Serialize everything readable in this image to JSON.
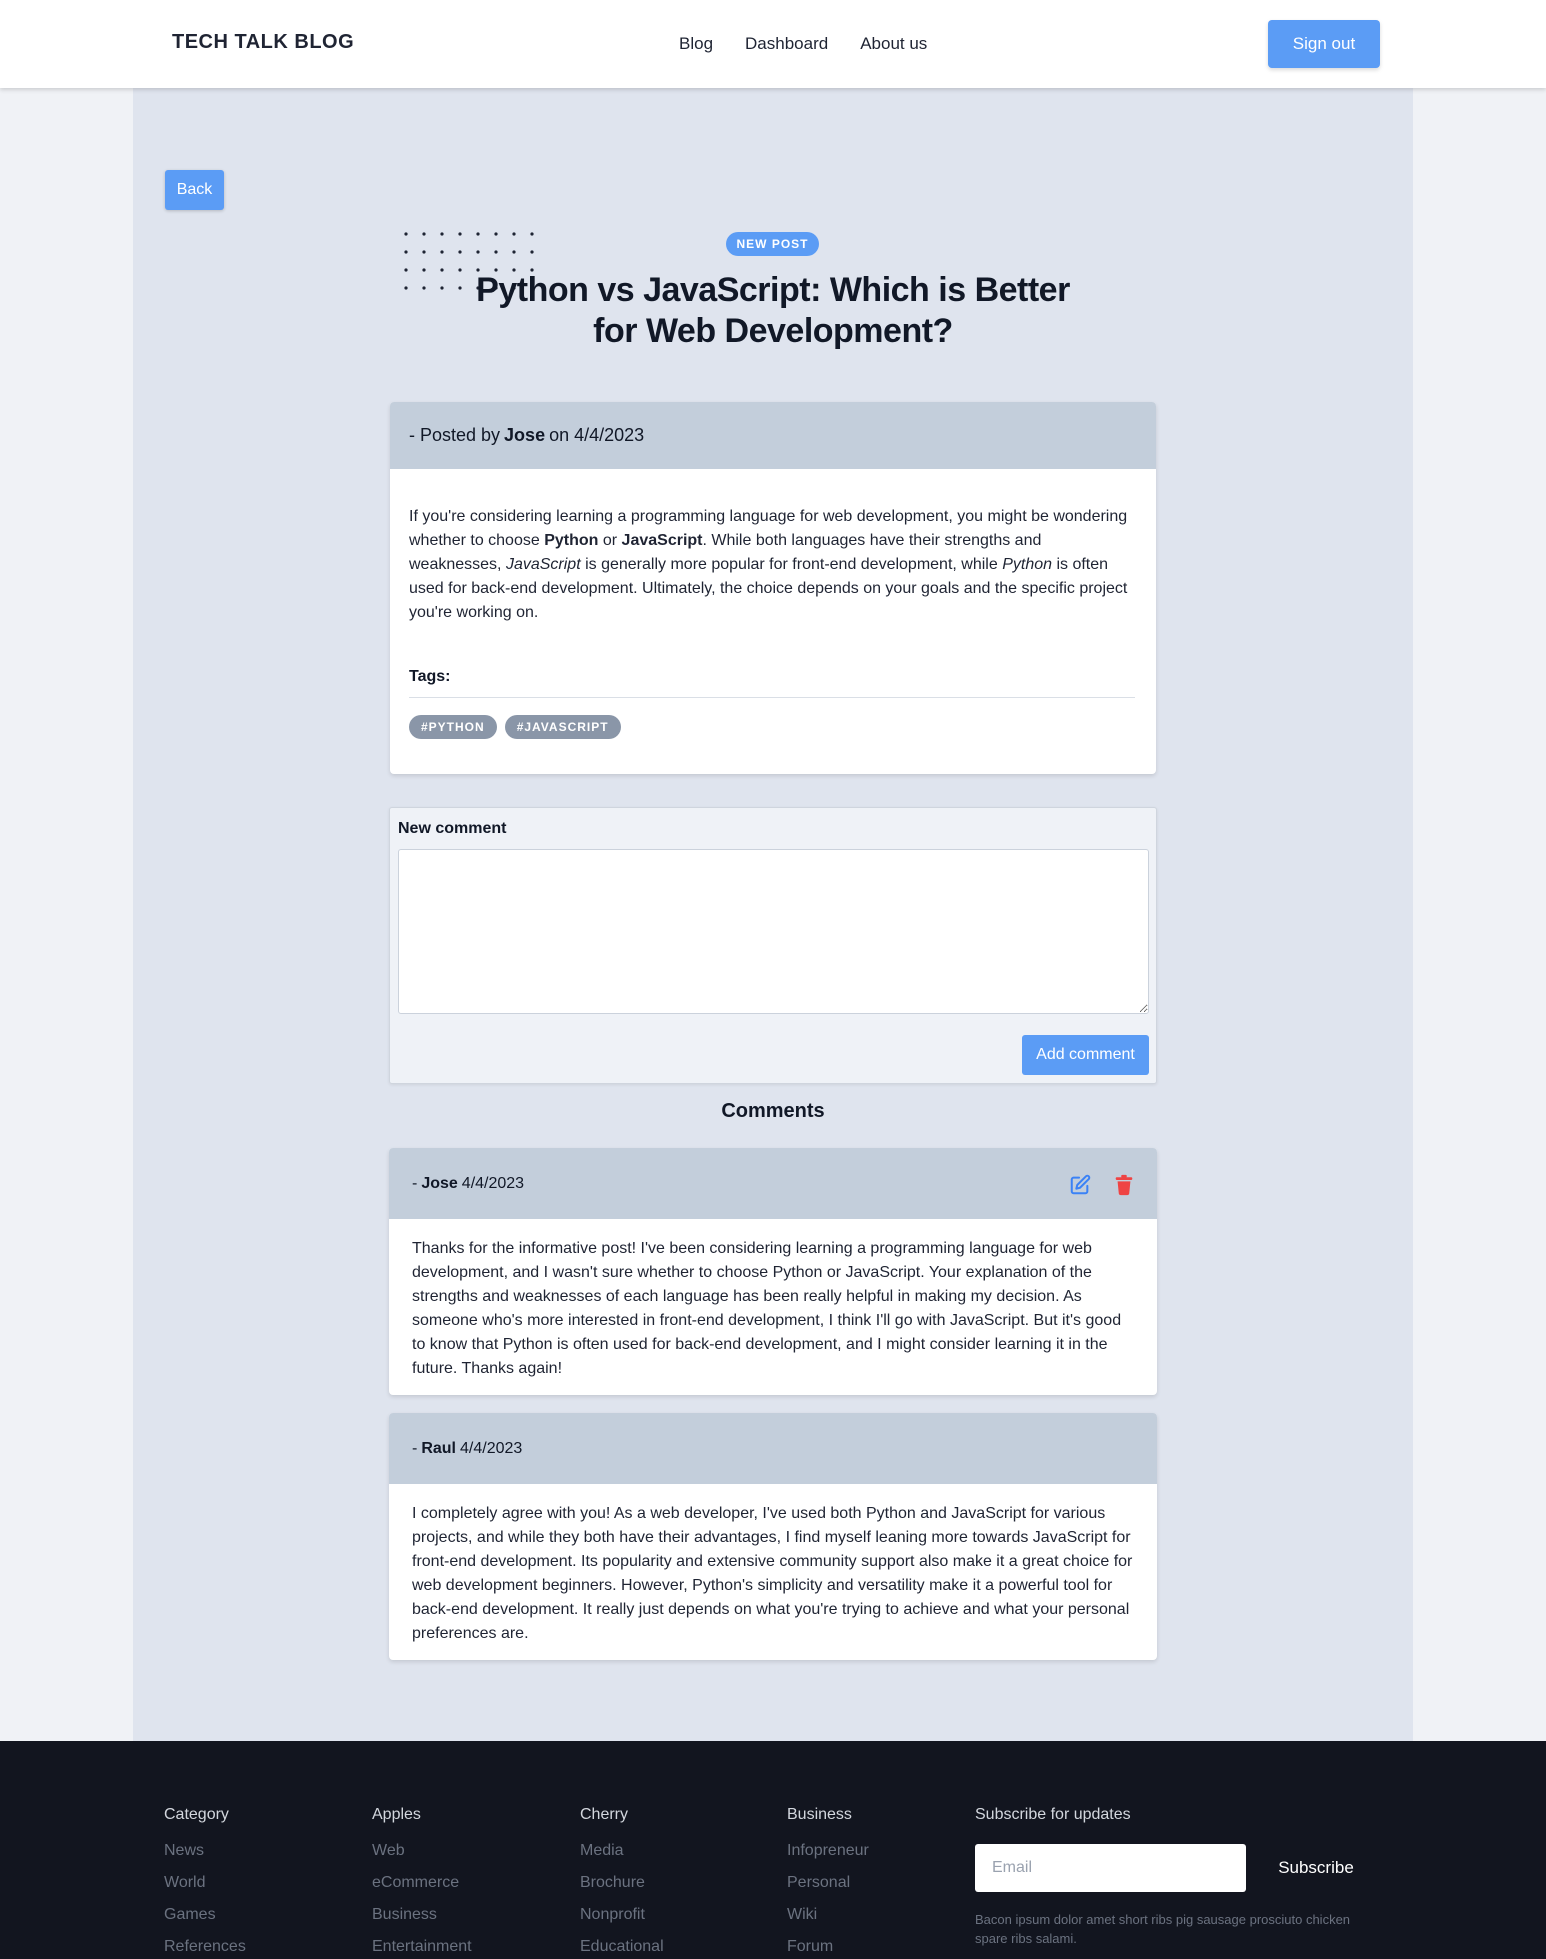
{
  "header": {
    "brand": "TECH TALK BLOG",
    "nav": [
      "Blog",
      "Dashboard",
      "About us"
    ],
    "signout_label": "Sign out"
  },
  "back_label": "Back",
  "post": {
    "badge": "NEW POST",
    "title": "Python vs JavaScript: Which is Better for Web Development?",
    "posted_prefix": "- Posted by",
    "author": "Jose",
    "date_prefix": "on",
    "date": "4/4/2023",
    "body": {
      "p1": "If you're considering learning a programming language for web development, you might be wondering whether to choose ",
      "b1": "Python",
      "p2": " or ",
      "b2": "JavaScript",
      "p3": ". While both languages have their strengths and weaknesses, ",
      "i1": "JavaScript",
      "p4": " is generally more popular for front-end development, while ",
      "i2": "Python",
      "p5": " is often used for back-end development. Ultimately, the choice depends on your goals and the specific project you're working on."
    },
    "tags_label": "Tags:",
    "tags": [
      "#PYTHON",
      "#JAVASCRIPT"
    ]
  },
  "comment_form": {
    "label": "New comment",
    "value": "",
    "button": "Add comment"
  },
  "comments_heading": "Comments",
  "comments": [
    {
      "prefix": "-",
      "author": "Jose",
      "date": "4/4/2023",
      "text": "Thanks for the informative post! I've been considering learning a programming language for web development, and I wasn't sure whether to choose Python or JavaScript. Your explanation of the strengths and weaknesses of each language has been really helpful in making my decision. As someone who's more interested in front-end development, I think I'll go with JavaScript. But it's good to know that Python is often used for back-end development, and I might consider learning it in the future. Thanks again!",
      "icons": [
        "edit-icon",
        "trash-icon"
      ]
    },
    {
      "prefix": "-",
      "author": "Raul",
      "date": "4/4/2023",
      "text": "I completely agree with you! As a web developer, I've used both Python and JavaScript for various projects, and while they both have their advantages, I find myself leaning more towards JavaScript for front-end development. Its popularity and extensive community support also make it a great choice for web development beginners. However, Python's simplicity and versatility make it a powerful tool for back-end development. It really just depends on what you're trying to achieve and what your personal preferences are."
    }
  ],
  "footer": {
    "columns": [
      {
        "heading": "Category",
        "items": [
          "News",
          "World",
          "Games",
          "References"
        ]
      },
      {
        "heading": "Apples",
        "items": [
          "Web",
          "eCommerce",
          "Business",
          "Entertainment"
        ]
      },
      {
        "heading": "Cherry",
        "items": [
          "Media",
          "Brochure",
          "Nonprofit",
          "Educational"
        ]
      },
      {
        "heading": "Business",
        "items": [
          "Infopreneur",
          "Personal",
          "Wiki",
          "Forum"
        ]
      }
    ],
    "subscribe": {
      "heading": "Subscribe for updates",
      "placeholder": "Email",
      "button": "Subscribe",
      "text": "Bacon ipsum dolor amet short ribs pig sausage prosciuto chicken spare ribs salami."
    }
  },
  "colors": {
    "accent": "#5b9cf5",
    "header_band": "#c3cedb",
    "edit_icon": "#3b82f6",
    "delete_icon": "#ef4444",
    "footer_bg": "#12151f"
  }
}
